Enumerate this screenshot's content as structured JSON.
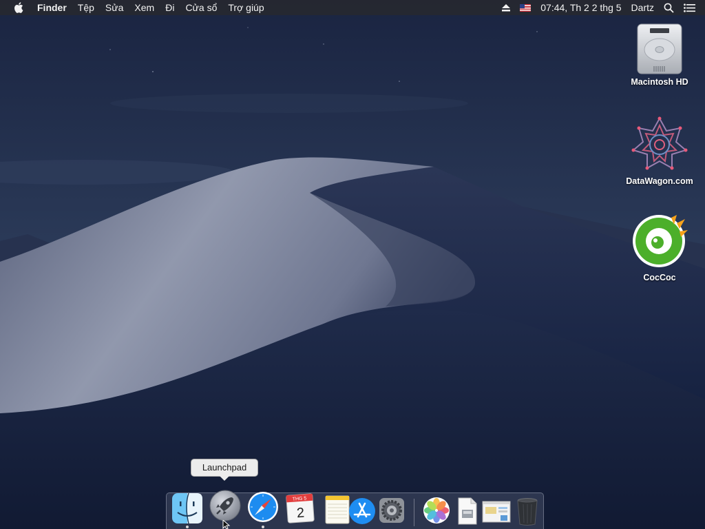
{
  "menubar": {
    "app_name": "Finder",
    "menus": [
      "Tệp",
      "Sửa",
      "Xem",
      "Đi",
      "Cửa sổ",
      "Trợ giúp"
    ],
    "clock": "07:44, Th 2 2 thg 5",
    "user": "Dartz",
    "icons": [
      "apple-icon",
      "eject-icon",
      "us-flag-icon",
      "search-icon",
      "notification-list-icon"
    ]
  },
  "desktop": {
    "icons": [
      {
        "label": "Macintosh HD",
        "icon": "hard-drive-icon"
      },
      {
        "label": "DataWagon.com",
        "icon": "datawagon-icon"
      },
      {
        "label": "CocCoc",
        "icon": "coccoc-icon"
      }
    ]
  },
  "tooltip": {
    "text": "Launchpad"
  },
  "dock": {
    "calendar": {
      "month": "THG 5",
      "day": "2"
    },
    "items": [
      {
        "name": "Finder",
        "icon": "finder-icon",
        "running": true
      },
      {
        "name": "Launchpad",
        "icon": "launchpad-icon",
        "running": false
      },
      {
        "name": "Safari",
        "icon": "safari-icon",
        "running": true
      },
      {
        "name": "Calendar",
        "icon": "calendar-icon",
        "running": false
      },
      {
        "name": "Notes",
        "icon": "notes-icon",
        "running": false
      },
      {
        "name": "App Store",
        "icon": "app-store-icon",
        "running": false
      },
      {
        "name": "System Preferences",
        "icon": "system-preferences-icon",
        "running": false
      },
      {
        "name": "Photos",
        "icon": "photos-icon",
        "running": false
      },
      {
        "name": "Document",
        "icon": "document-icon",
        "running": false
      },
      {
        "name": "Screen preview",
        "icon": "screen-preview-icon",
        "running": false
      },
      {
        "name": "Trash",
        "icon": "trash-icon",
        "running": false
      }
    ]
  },
  "colors": {
    "sky_top": "#1c2744",
    "sky_bottom": "#2f3e5c",
    "dune_light": "#8a90a6",
    "dune_shadow": "#1b2642",
    "menubar_bg": "#26282f",
    "coccoc_green": "#4caf2a"
  }
}
